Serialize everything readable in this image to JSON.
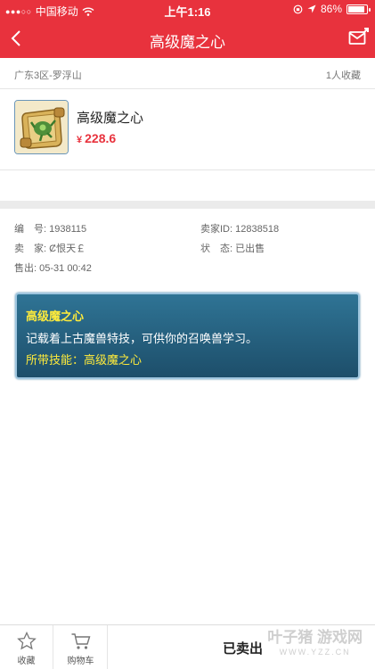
{
  "status_bar": {
    "carrier": "中国移动",
    "time": "上午1:16",
    "battery": "86%",
    "signal_icon": "signal-dots-icon",
    "wifi_icon": "wifi-icon",
    "location_icon": "location-arrow-icon"
  },
  "nav": {
    "title": "高级魔之心",
    "back_icon": "chevron-left-icon",
    "mail_icon": "envelope-icon"
  },
  "server": {
    "name": "广东3区-罗浮山",
    "favorites": "1人收藏"
  },
  "item": {
    "name": "高级魔之心",
    "currency": "¥",
    "price": "228.6",
    "icon": "scroll-item-icon"
  },
  "details": {
    "id_label": "编　号:",
    "id_value": "1938115",
    "seller_id_label": "卖家ID:",
    "seller_id_value": "12838518",
    "seller_label": "卖　家:",
    "seller_value": "Ȼ恨天￡",
    "status_label": "状　态:",
    "status_value": "已出售",
    "sold_label": "售出:",
    "sold_value": "05-31 00:42"
  },
  "skill_box": {
    "title": "高级魔之心",
    "description": "记载着上古魔兽特技，可供你的召唤兽学习。",
    "skill_line": "所带技能：高级魔之心"
  },
  "bottom": {
    "favorite_label": "收藏",
    "cart_label": "购物车",
    "sold_label": "已卖出",
    "watermark_main": "叶子猪",
    "watermark_sub": "游戏网",
    "watermark_url": "WWW.YZZ.CN"
  },
  "colors": {
    "brand_red": "#e8323d",
    "skill_bg": "#2f7495",
    "skill_highlight": "#ffeb3b"
  }
}
